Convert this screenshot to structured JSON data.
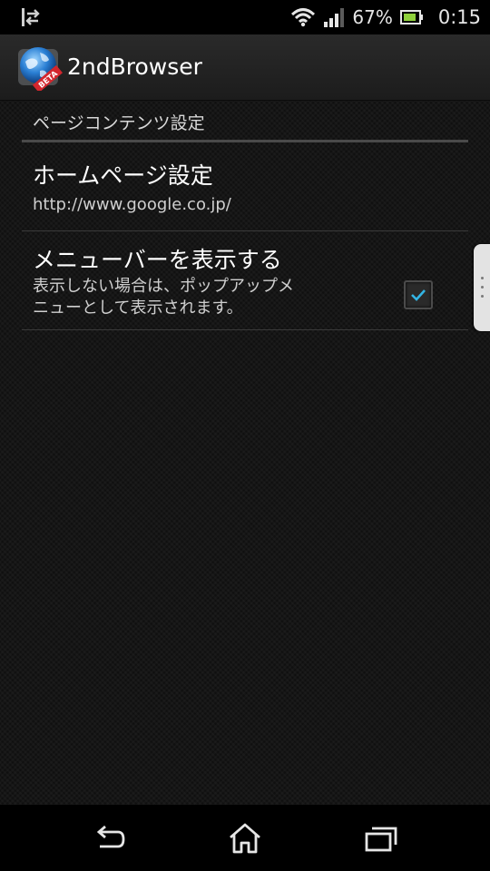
{
  "status_bar": {
    "battery_percent": "67%",
    "time": "0:15"
  },
  "action_bar": {
    "title": "2ndBrowser",
    "icon_badge": "BETA"
  },
  "settings": {
    "category": "ページコンテンツ設定",
    "items": [
      {
        "title": "ホームページ設定",
        "summary": "http://www.google.co.jp/"
      },
      {
        "title": "メニューバーを表示する",
        "summary_line1": "表示しない場合は、ポップアップメ",
        "summary_line2": "ニューとして表示されます。",
        "checked": true
      }
    ]
  },
  "colors": {
    "accent": "#33b5e5"
  }
}
